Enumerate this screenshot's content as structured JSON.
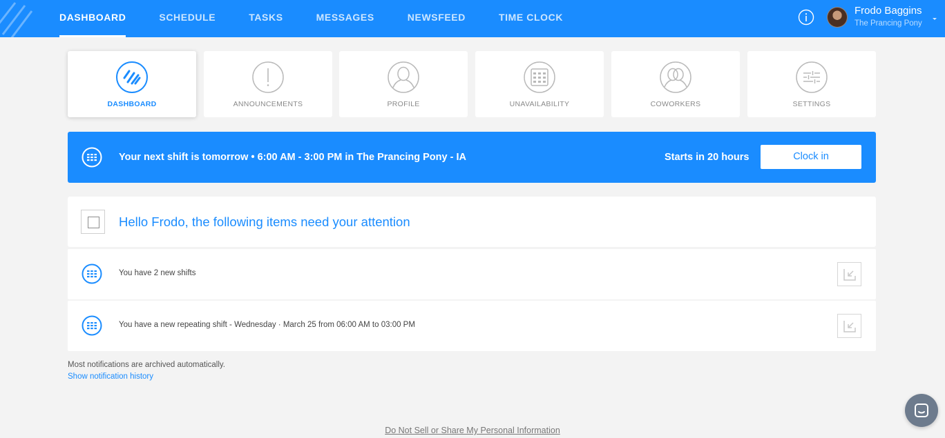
{
  "nav": {
    "items": [
      {
        "label": "DASHBOARD",
        "active": true
      },
      {
        "label": "SCHEDULE",
        "active": false
      },
      {
        "label": "TASKS",
        "active": false
      },
      {
        "label": "MESSAGES",
        "active": false
      },
      {
        "label": "NEWSFEED",
        "active": false
      },
      {
        "label": "TIME CLOCK",
        "active": false
      }
    ],
    "info_icon": "info-circle-icon"
  },
  "user": {
    "name": "Frodo Baggins",
    "location": "The Prancing Pony"
  },
  "tiles": [
    {
      "label": "DASHBOARD",
      "icon": "dashboard-logo-icon",
      "active": true
    },
    {
      "label": "ANNOUNCEMENTS",
      "icon": "exclamation-icon",
      "active": false
    },
    {
      "label": "PROFILE",
      "icon": "person-icon",
      "active": false
    },
    {
      "label": "UNAVAILABILITY",
      "icon": "calendar-icon",
      "active": false
    },
    {
      "label": "COWORKERS",
      "icon": "people-icon",
      "active": false
    },
    {
      "label": "SETTINGS",
      "icon": "sliders-icon",
      "active": false
    }
  ],
  "shift": {
    "text": "Your next shift is tomorrow • 6:00 AM - 3:00 PM in The Prancing Pony - IA",
    "starts": "Starts in 20 hours",
    "button": "Clock in"
  },
  "attention": {
    "title": "Hello Frodo, the following items need your attention"
  },
  "notifications": [
    {
      "text": "You have 2 new shifts"
    },
    {
      "text": "You have a new repeating shift - Wednesday · March 25 from 06:00 AM to 03:00 PM"
    }
  ],
  "archived_note": "Most notifications are archived automatically.",
  "history_link": "Show notification history",
  "footer_link": "Do Not Sell or Share My Personal Information",
  "colors": {
    "brand": "#1a8cff",
    "background": "#f3f3f3",
    "chat": "#6d7b8d"
  }
}
